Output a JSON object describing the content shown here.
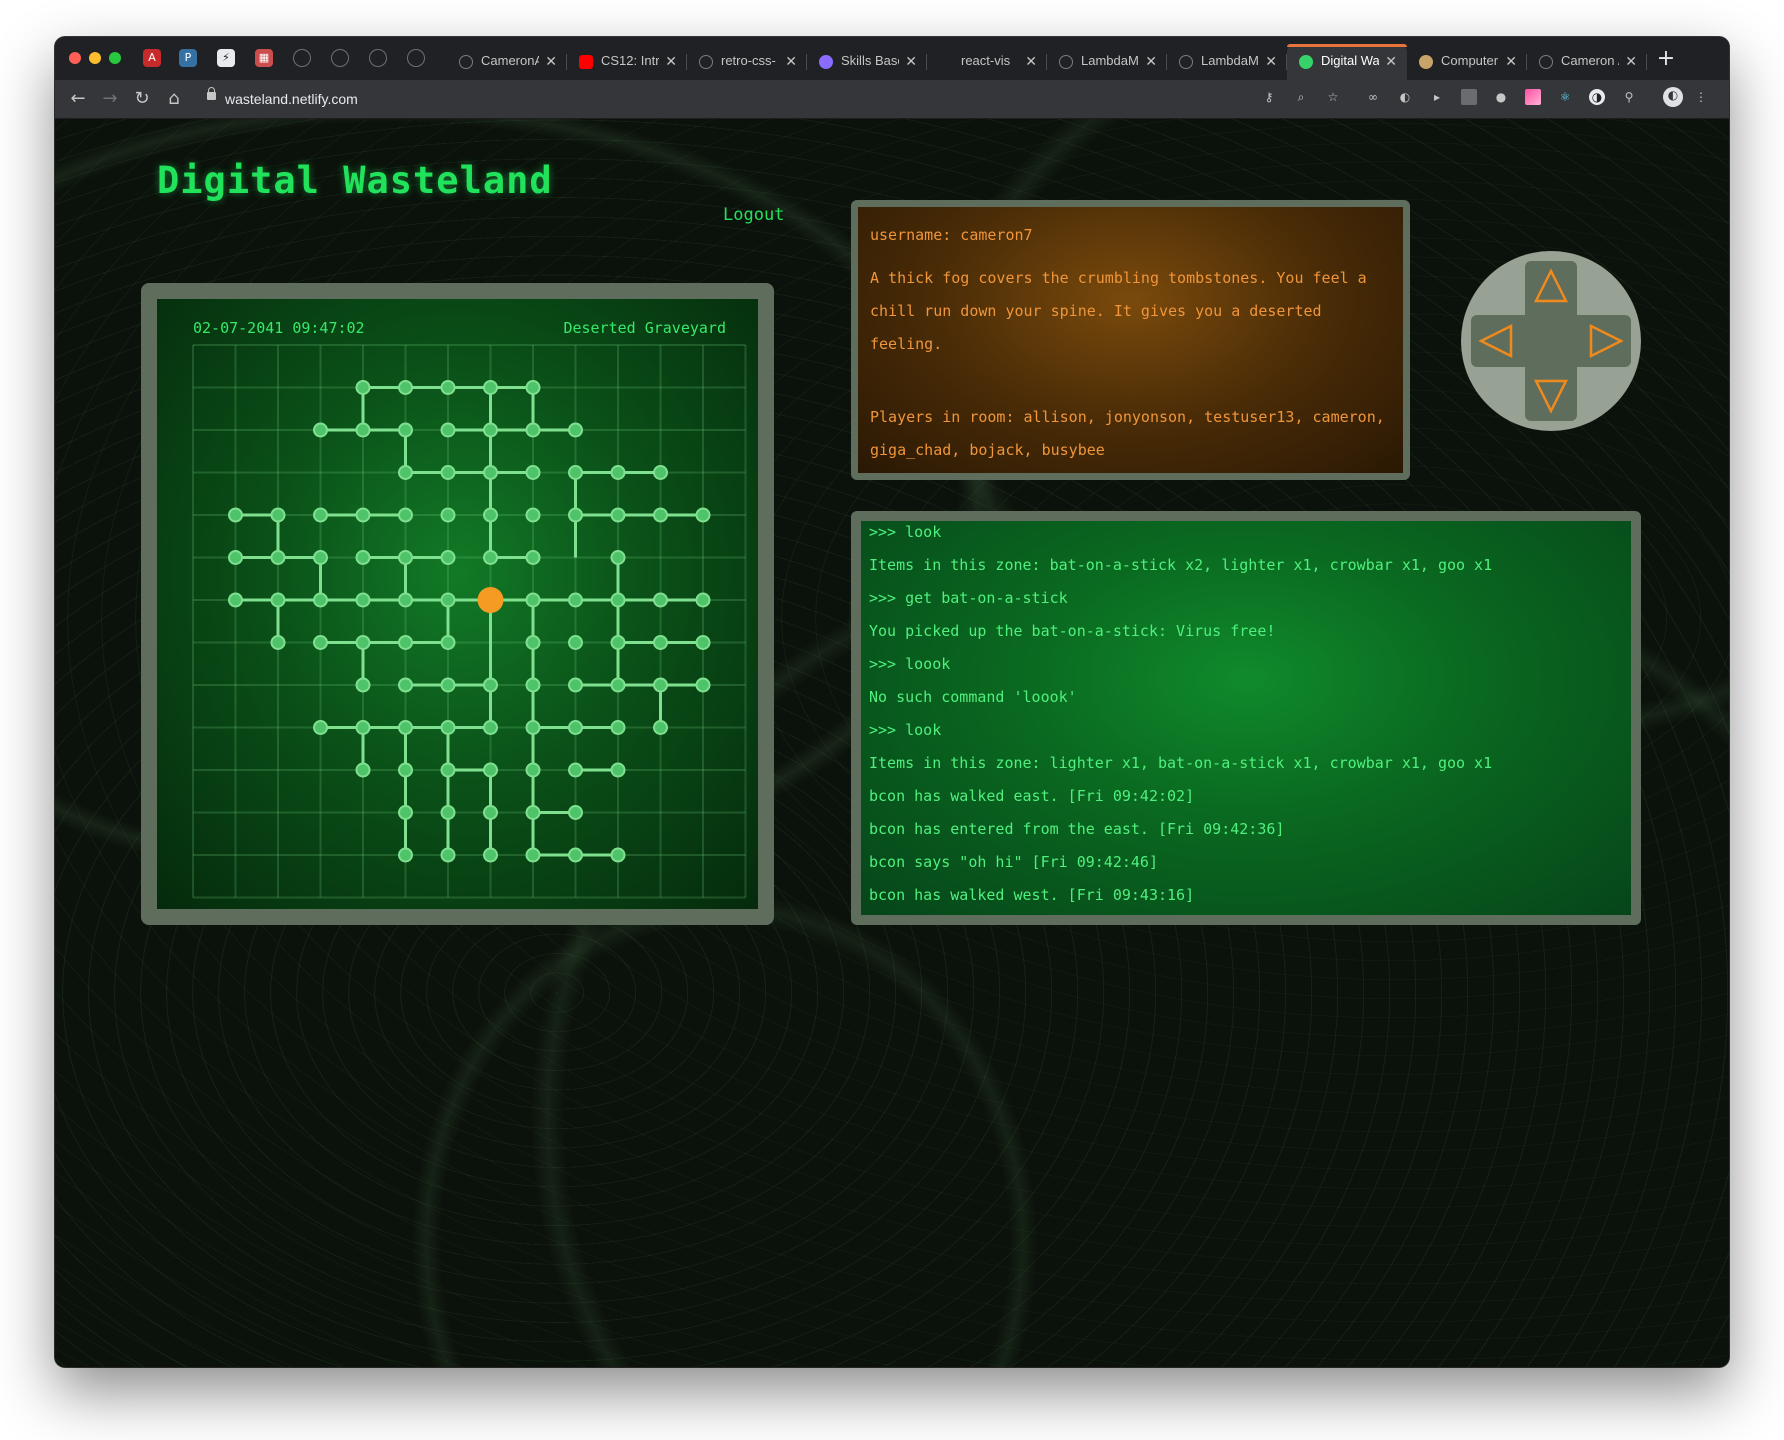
{
  "browser": {
    "tabs": [
      {
        "title": "CameronA",
        "favicon": "github-icon",
        "active": false
      },
      {
        "title": "CS12: Intro",
        "favicon": "youtube-icon",
        "active": false
      },
      {
        "title": "retro-css-",
        "favicon": "github-icon",
        "active": false
      },
      {
        "title": "Skills Base",
        "favicon": "skills-icon",
        "active": false
      },
      {
        "title": "react-vis",
        "favicon": "none",
        "active": false
      },
      {
        "title": "LambdaM",
        "favicon": "github-icon",
        "active": false
      },
      {
        "title": "LambdaM",
        "favicon": "github-icon",
        "active": false
      },
      {
        "title": "Digital Wa",
        "favicon": "react-icon",
        "active": true
      },
      {
        "title": "Computer",
        "favicon": "coffee-icon",
        "active": false
      },
      {
        "title": "Cameron /",
        "favicon": "globe-icon",
        "active": false
      }
    ],
    "url": "wasteland.netlify.com",
    "accent": "#e8743b"
  },
  "page": {
    "title": "Digital Wasteland",
    "logout_label": "Logout",
    "title_color": "#21e25b"
  },
  "map": {
    "datetime": "02-07-2041 09:47:02",
    "room_name": "Deserted Graveyard",
    "grid_size": 13,
    "current_room": [
      7,
      6
    ],
    "player_color": "#f59a23",
    "node_color": "#7fe08f",
    "rooms": [
      [
        4,
        1
      ],
      [
        5,
        1
      ],
      [
        6,
        1
      ],
      [
        7,
        1
      ],
      [
        8,
        1
      ],
      [
        3,
        2
      ],
      [
        4,
        2
      ],
      [
        5,
        2
      ],
      [
        6,
        2
      ],
      [
        7,
        2
      ],
      [
        8,
        2
      ],
      [
        9,
        2
      ],
      [
        5,
        3
      ],
      [
        6,
        3
      ],
      [
        7,
        3
      ],
      [
        8,
        3
      ],
      [
        9,
        3
      ],
      [
        10,
        3
      ],
      [
        11,
        3
      ],
      [
        1,
        4
      ],
      [
        2,
        4
      ],
      [
        3,
        4
      ],
      [
        4,
        4
      ],
      [
        5,
        4
      ],
      [
        6,
        4
      ],
      [
        7,
        4
      ],
      [
        8,
        4
      ],
      [
        9,
        4
      ],
      [
        10,
        4
      ],
      [
        11,
        4
      ],
      [
        12,
        4
      ],
      [
        1,
        5
      ],
      [
        2,
        5
      ],
      [
        3,
        5
      ],
      [
        4,
        5
      ],
      [
        5,
        5
      ],
      [
        6,
        5
      ],
      [
        7,
        5
      ],
      [
        8,
        5
      ],
      [
        10,
        5
      ],
      [
        1,
        6
      ],
      [
        2,
        6
      ],
      [
        3,
        6
      ],
      [
        4,
        6
      ],
      [
        5,
        6
      ],
      [
        6,
        6
      ],
      [
        7,
        6
      ],
      [
        8,
        6
      ],
      [
        9,
        6
      ],
      [
        10,
        6
      ],
      [
        11,
        6
      ],
      [
        12,
        6
      ],
      [
        2,
        7
      ],
      [
        3,
        7
      ],
      [
        4,
        7
      ],
      [
        5,
        7
      ],
      [
        6,
        7
      ],
      [
        8,
        7
      ],
      [
        9,
        7
      ],
      [
        10,
        7
      ],
      [
        11,
        7
      ],
      [
        12,
        7
      ],
      [
        4,
        8
      ],
      [
        5,
        8
      ],
      [
        6,
        8
      ],
      [
        7,
        8
      ],
      [
        8,
        8
      ],
      [
        9,
        8
      ],
      [
        10,
        8
      ],
      [
        11,
        8
      ],
      [
        12,
        8
      ],
      [
        3,
        9
      ],
      [
        4,
        9
      ],
      [
        5,
        9
      ],
      [
        6,
        9
      ],
      [
        7,
        9
      ],
      [
        8,
        9
      ],
      [
        9,
        9
      ],
      [
        10,
        9
      ],
      [
        11,
        9
      ],
      [
        4,
        10
      ],
      [
        5,
        10
      ],
      [
        6,
        10
      ],
      [
        7,
        10
      ],
      [
        8,
        10
      ],
      [
        9,
        10
      ],
      [
        10,
        10
      ],
      [
        5,
        11
      ],
      [
        6,
        11
      ],
      [
        7,
        11
      ],
      [
        8,
        11
      ],
      [
        9,
        11
      ],
      [
        5,
        12
      ],
      [
        6,
        12
      ],
      [
        7,
        12
      ],
      [
        8,
        12
      ],
      [
        9,
        12
      ],
      [
        10,
        12
      ]
    ],
    "connections": [
      [
        [
          4,
          1
        ],
        [
          5,
          1
        ]
      ],
      [
        [
          5,
          1
        ],
        [
          6,
          1
        ]
      ],
      [
        [
          6,
          1
        ],
        [
          7,
          1
        ]
      ],
      [
        [
          7,
          1
        ],
        [
          8,
          1
        ]
      ],
      [
        [
          4,
          1
        ],
        [
          4,
          2
        ]
      ],
      [
        [
          7,
          1
        ],
        [
          7,
          2
        ]
      ],
      [
        [
          8,
          1
        ],
        [
          8,
          2
        ]
      ],
      [
        [
          3,
          2
        ],
        [
          4,
          2
        ]
      ],
      [
        [
          4,
          2
        ],
        [
          5,
          2
        ]
      ],
      [
        [
          6,
          2
        ],
        [
          7,
          2
        ]
      ],
      [
        [
          7,
          2
        ],
        [
          8,
          2
        ]
      ],
      [
        [
          8,
          2
        ],
        [
          9,
          2
        ]
      ],
      [
        [
          5,
          2
        ],
        [
          5,
          3
        ]
      ],
      [
        [
          7,
          2
        ],
        [
          7,
          3
        ]
      ],
      [
        [
          5,
          3
        ],
        [
          6,
          3
        ]
      ],
      [
        [
          6,
          3
        ],
        [
          7,
          3
        ]
      ],
      [
        [
          7,
          3
        ],
        [
          8,
          3
        ]
      ],
      [
        [
          9,
          3
        ],
        [
          10,
          3
        ]
      ],
      [
        [
          10,
          3
        ],
        [
          11,
          3
        ]
      ],
      [
        [
          7,
          3
        ],
        [
          7,
          4
        ]
      ],
      [
        [
          9,
          3
        ],
        [
          9,
          4
        ]
      ],
      [
        [
          1,
          4
        ],
        [
          2,
          4
        ]
      ],
      [
        [
          3,
          4
        ],
        [
          4,
          4
        ]
      ],
      [
        [
          4,
          4
        ],
        [
          5,
          4
        ]
      ],
      [
        [
          9,
          4
        ],
        [
          10,
          4
        ]
      ],
      [
        [
          10,
          4
        ],
        [
          11,
          4
        ]
      ],
      [
        [
          11,
          4
        ],
        [
          12,
          4
        ]
      ],
      [
        [
          2,
          4
        ],
        [
          2,
          5
        ]
      ],
      [
        [
          7,
          4
        ],
        [
          7,
          5
        ]
      ],
      [
        [
          9,
          4
        ],
        [
          9,
          5
        ]
      ],
      [
        [
          1,
          5
        ],
        [
          2,
          5
        ]
      ],
      [
        [
          2,
          5
        ],
        [
          3,
          5
        ]
      ],
      [
        [
          4,
          5
        ],
        [
          5,
          5
        ]
      ],
      [
        [
          5,
          5
        ],
        [
          6,
          5
        ]
      ],
      [
        [
          7,
          5
        ],
        [
          8,
          5
        ]
      ],
      [
        [
          3,
          5
        ],
        [
          3,
          6
        ]
      ],
      [
        [
          5,
          5
        ],
        [
          5,
          6
        ]
      ],
      [
        [
          10,
          5
        ],
        [
          10,
          6
        ]
      ],
      [
        [
          1,
          6
        ],
        [
          2,
          6
        ]
      ],
      [
        [
          2,
          6
        ],
        [
          3,
          6
        ]
      ],
      [
        [
          3,
          6
        ],
        [
          4,
          6
        ]
      ],
      [
        [
          4,
          6
        ],
        [
          5,
          6
        ]
      ],
      [
        [
          5,
          6
        ],
        [
          6,
          6
        ]
      ],
      [
        [
          6,
          6
        ],
        [
          7,
          6
        ]
      ],
      [
        [
          7,
          6
        ],
        [
          8,
          6
        ]
      ],
      [
        [
          8,
          6
        ],
        [
          9,
          6
        ]
      ],
      [
        [
          9,
          6
        ],
        [
          10,
          6
        ]
      ],
      [
        [
          10,
          6
        ],
        [
          11,
          6
        ]
      ],
      [
        [
          11,
          6
        ],
        [
          12,
          6
        ]
      ],
      [
        [
          2,
          6
        ],
        [
          2,
          7
        ]
      ],
      [
        [
          6,
          6
        ],
        [
          6,
          7
        ]
      ],
      [
        [
          7,
          6
        ],
        [
          7,
          7
        ]
      ],
      [
        [
          8,
          6
        ],
        [
          8,
          7
        ]
      ],
      [
        [
          10,
          6
        ],
        [
          10,
          7
        ]
      ],
      [
        [
          3,
          7
        ],
        [
          4,
          7
        ]
      ],
      [
        [
          4,
          7
        ],
        [
          5,
          7
        ]
      ],
      [
        [
          5,
          7
        ],
        [
          6,
          7
        ]
      ],
      [
        [
          10,
          7
        ],
        [
          11,
          7
        ]
      ],
      [
        [
          11,
          7
        ],
        [
          12,
          7
        ]
      ],
      [
        [
          4,
          7
        ],
        [
          4,
          8
        ]
      ],
      [
        [
          7,
          7
        ],
        [
          7,
          8
        ]
      ],
      [
        [
          8,
          7
        ],
        [
          8,
          8
        ]
      ],
      [
        [
          10,
          7
        ],
        [
          10,
          8
        ]
      ],
      [
        [
          5,
          8
        ],
        [
          6,
          8
        ]
      ],
      [
        [
          6,
          8
        ],
        [
          7,
          8
        ]
      ],
      [
        [
          9,
          8
        ],
        [
          10,
          8
        ]
      ],
      [
        [
          10,
          8
        ],
        [
          11,
          8
        ]
      ],
      [
        [
          11,
          8
        ],
        [
          12,
          8
        ]
      ],
      [
        [
          7,
          8
        ],
        [
          7,
          9
        ]
      ],
      [
        [
          8,
          8
        ],
        [
          8,
          9
        ]
      ],
      [
        [
          11,
          8
        ],
        [
          11,
          9
        ]
      ],
      [
        [
          3,
          9
        ],
        [
          4,
          9
        ]
      ],
      [
        [
          4,
          9
        ],
        [
          5,
          9
        ]
      ],
      [
        [
          5,
          9
        ],
        [
          6,
          9
        ]
      ],
      [
        [
          6,
          9
        ],
        [
          7,
          9
        ]
      ],
      [
        [
          8,
          9
        ],
        [
          9,
          9
        ]
      ],
      [
        [
          9,
          9
        ],
        [
          10,
          9
        ]
      ],
      [
        [
          4,
          9
        ],
        [
          4,
          10
        ]
      ],
      [
        [
          5,
          9
        ],
        [
          5,
          10
        ]
      ],
      [
        [
          6,
          9
        ],
        [
          6,
          10
        ]
      ],
      [
        [
          8,
          9
        ],
        [
          8,
          10
        ]
      ],
      [
        [
          6,
          10
        ],
        [
          7,
          10
        ]
      ],
      [
        [
          9,
          10
        ],
        [
          10,
          10
        ]
      ],
      [
        [
          5,
          10
        ],
        [
          5,
          11
        ]
      ],
      [
        [
          6,
          10
        ],
        [
          6,
          11
        ]
      ],
      [
        [
          7,
          10
        ],
        [
          7,
          11
        ]
      ],
      [
        [
          8,
          10
        ],
        [
          8,
          11
        ]
      ],
      [
        [
          8,
          11
        ],
        [
          9,
          11
        ]
      ],
      [
        [
          5,
          11
        ],
        [
          5,
          12
        ]
      ],
      [
        [
          6,
          11
        ],
        [
          6,
          12
        ]
      ],
      [
        [
          7,
          11
        ],
        [
          7,
          12
        ]
      ],
      [
        [
          8,
          11
        ],
        [
          8,
          12
        ]
      ],
      [
        [
          8,
          12
        ],
        [
          9,
          12
        ]
      ],
      [
        [
          9,
          12
        ],
        [
          10,
          12
        ]
      ]
    ]
  },
  "room": {
    "username_line": "username: cameron7",
    "description": "A thick fog covers the crumbling tombstones. You feel a chill run down your spine. It gives you a deserted feeling.",
    "players_line": "Players in room: allison, jonyonson, testuser13, cameron, giga_chad, bojack, busybee",
    "text_color": "#f0953a"
  },
  "dpad": {
    "up_label": "△",
    "down_label": "▽",
    "left_label": "◁",
    "right_label": "▷",
    "arrow_color": "#f08a1c"
  },
  "console": {
    "lines": [
      ">>> look",
      "Items in this zone: bat-on-a-stick x2, lighter x1, crowbar x1, goo x1",
      ">>> get bat-on-a-stick",
      "You picked up the bat-on-a-stick: Virus free!",
      ">>> loook",
      "No such command 'loook'",
      ">>> look",
      "Items in this zone: lighter x1, bat-on-a-stick x1, crowbar x1, goo x1",
      "bcon has walked east. [Fri 09:42:02]",
      "bcon has entered from the east. [Fri 09:42:36]",
      "bcon says \"oh hi\" [Fri 09:42:46]",
      "bcon has walked west. [Fri 09:43:16]"
    ],
    "prompt": "$ >",
    "text_color": "#4ff07e"
  }
}
